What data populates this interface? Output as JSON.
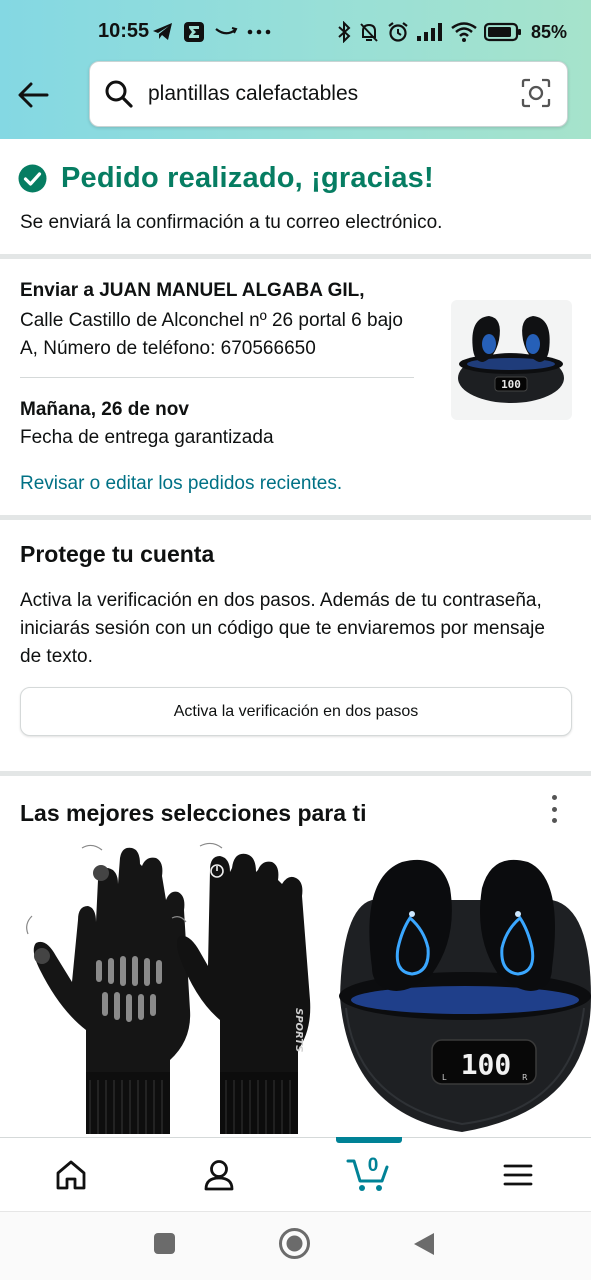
{
  "status_bar": {
    "time": "10:55",
    "battery": "85%",
    "left_icons": [
      "telegram-icon",
      "sigma-app-icon",
      "amazon-smile-icon",
      "more-dots-icon"
    ],
    "right_icons": [
      "bluetooth-icon",
      "bell-off-icon",
      "alarm-icon",
      "signal-icon",
      "wifi-icon",
      "battery-icon"
    ]
  },
  "header": {
    "search_value": "plantillas calefactables",
    "colors": {
      "gradient_start": "#84d8e3",
      "gradient_end": "#a6e3cb"
    }
  },
  "confirmation": {
    "title": "Pedido realizado, ¡gracias!",
    "subtitle": "Se enviará la confirmación a tu correo electrónico.",
    "color": "#067d62"
  },
  "shipping": {
    "recipient": "Enviar a JUAN MANUEL ALGABA GIL,",
    "address": "Calle Castillo de Alconchel nº 26 portal 6 bajo A, Número de teléfono: 670566650",
    "delivery_date": "Mañana, 26 de nov",
    "delivery_note": "Fecha de entrega garantizada",
    "review_link": "Revisar o editar los pedidos recientes.",
    "thumbnail_readout": "100"
  },
  "protect": {
    "title": "Protege tu cuenta",
    "body": "Activa la verificación en dos pasos. Además de tu contraseña, iniciarás sesión con un código que te enviaremos por mensaje de texto.",
    "button_label": "Activa la verificación en dos pasos"
  },
  "picks": {
    "title": "Las mejores selecciones para ti",
    "gloves_brand_text": "SPORTS",
    "earbuds_readout": "100",
    "earbuds_left_label": "L",
    "earbuds_right_label": "R"
  },
  "bottom_nav": {
    "items": [
      "home-icon",
      "account-icon",
      "cart-icon",
      "menu-icon"
    ],
    "cart_count": "0",
    "active_color": "#008296"
  }
}
